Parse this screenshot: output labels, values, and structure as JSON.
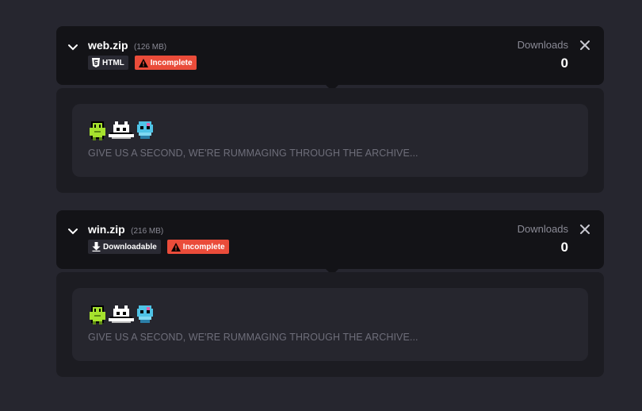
{
  "uploads": [
    {
      "filename": "web.zip",
      "size": "(126 MB)",
      "platform_tag": {
        "label": "HTML",
        "icon": "html5-icon"
      },
      "status_tag": {
        "label": "Incomplete",
        "icon": "warning-icon",
        "color": "#ea4c3a"
      },
      "downloads_label": "Downloads",
      "downloads_count": "0",
      "loading_text": "GIVE US A SECOND, WE'RE RUMMAGING THROUGH THE ARCHIVE..."
    },
    {
      "filename": "win.zip",
      "size": "(216 MB)",
      "platform_tag": {
        "label": "Downloadable",
        "icon": "download-icon"
      },
      "status_tag": {
        "label": "Incomplete",
        "icon": "warning-icon",
        "color": "#ea4c3a"
      },
      "downloads_label": "Downloads",
      "downloads_count": "0",
      "loading_text": "GIVE US A SECOND, WE'RE RUMMAGING THROUGH THE ARCHIVE..."
    }
  ],
  "colors": {
    "background": "#26262f",
    "header": "#131317",
    "panel": "#1c1c22",
    "inner": "#26262e",
    "warning": "#ea4c3a",
    "sprite_green": "#a6e22e",
    "sprite_blue": "#4fc3e6"
  }
}
